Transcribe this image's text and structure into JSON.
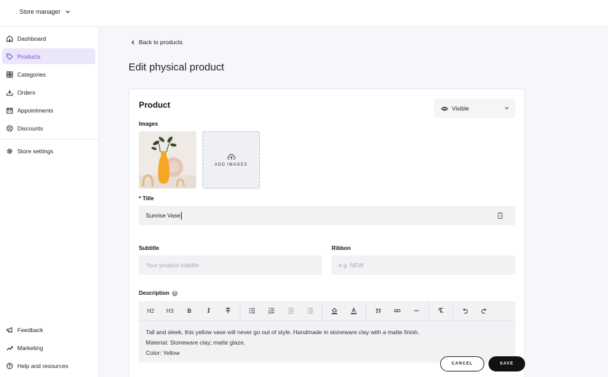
{
  "topbar": {
    "store_name": "Store manager"
  },
  "sidebar": {
    "items": [
      {
        "label": "Dashboard",
        "icon": "home-icon"
      },
      {
        "label": "Products",
        "icon": "tag-icon",
        "active": true
      },
      {
        "label": "Categories",
        "icon": "grid-icon"
      },
      {
        "label": "Orders",
        "icon": "download-icon"
      },
      {
        "label": "Appointments",
        "icon": "calendar-icon"
      },
      {
        "label": "Discounts",
        "icon": "discount-icon"
      },
      {
        "label": "Store settings",
        "icon": "gear-icon"
      }
    ],
    "bottom_items": [
      {
        "label": "Feedback",
        "icon": "megaphone-icon"
      },
      {
        "label": "Marketing",
        "icon": "trend-icon"
      },
      {
        "label": "Help and resources",
        "icon": "help-icon"
      }
    ]
  },
  "main": {
    "back_label": "Back to products",
    "page_title": "Edit physical product"
  },
  "product": {
    "card_title": "Product",
    "visibility": "Visible",
    "images_label": "Images",
    "add_images_label": "ADD IMAGES",
    "title_label": "* Title",
    "title_value": "Sunrise Vase",
    "subtitle_label": "Subtitle",
    "subtitle_placeholder": "Your product subtitle",
    "ribbon_label": "Ribbon",
    "ribbon_placeholder": "e.g. NEW",
    "description_label": "Description",
    "description_lines": [
      "Tall and sleek, this yellow vase will never go out of style. Handmade in stoneware clay with a matte finish.",
      "Material: Stoneware clay; matte glaze.",
      "Color: Yellow"
    ]
  },
  "toolbar": {
    "h2": "H2",
    "h3": "H3",
    "bold": "B",
    "italic": "I",
    "strike": "T"
  },
  "actions": {
    "cancel": "CANCEL",
    "save": "SAVE"
  },
  "colors": {
    "accent": "#6b4fd8",
    "active_bg": "#ebe6f9",
    "main_bg": "#f6f7fa",
    "vase": "#f5a623"
  }
}
